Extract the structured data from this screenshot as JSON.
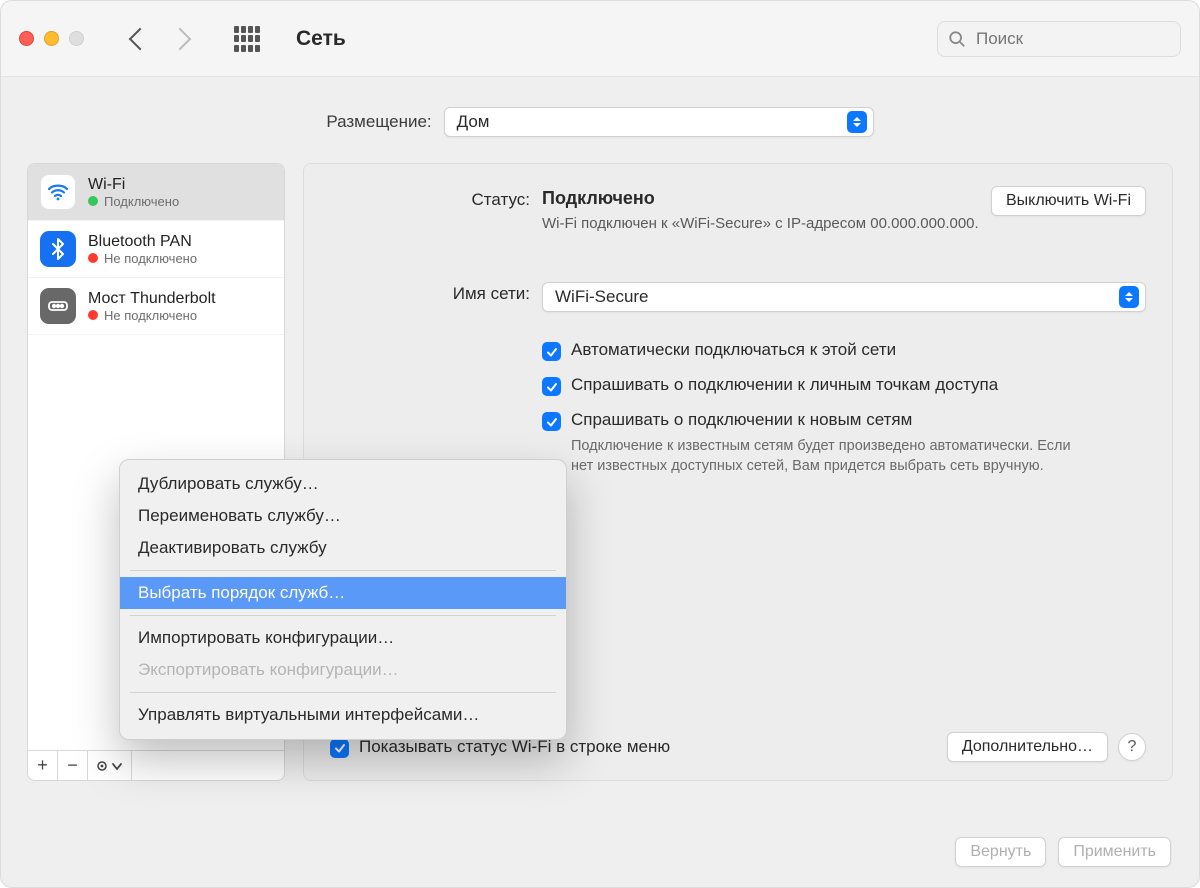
{
  "toolbar": {
    "title": "Сеть",
    "search_placeholder": "Поиск"
  },
  "location": {
    "label": "Размещение:",
    "value": "Дом"
  },
  "sidebar": {
    "services": [
      {
        "name": "Wi-Fi",
        "status": "Подключено",
        "status_color": "green",
        "icon": "wifi",
        "selected": true
      },
      {
        "name": "Bluetooth PAN",
        "status": "Не подключено",
        "status_color": "red",
        "icon": "bt",
        "selected": false
      },
      {
        "name": "Мост Thunderbolt",
        "status": "Не подключено",
        "status_color": "red",
        "icon": "tb",
        "selected": false
      }
    ]
  },
  "details": {
    "status_label": "Статус:",
    "status_value": "Подключено",
    "status_sub": "Wi-Fi подключен к «WiFi-Secure» с IP-адресом 00.000.000.000.",
    "turn_off_label": "Выключить Wi-Fi",
    "network_label": "Имя сети:",
    "network_value": "WiFi-Secure",
    "checks": [
      {
        "checked": true,
        "label": "Автоматически подключаться к этой сети"
      },
      {
        "checked": true,
        "label": "Спрашивать о подключении к личным точкам доступа"
      },
      {
        "checked": true,
        "label": "Спрашивать о подключении к новым сетям",
        "sub": "Подключение к известным сетям будет произведено автоматически. Если нет известных доступных сетей, Вам придется выбрать сеть вручную."
      }
    ],
    "show_status_label": "Показывать статус Wi-Fi в строке меню",
    "advanced_label": "Дополнительно…"
  },
  "footer": {
    "revert": "Вернуть",
    "apply": "Применить"
  },
  "context_menu": {
    "items": [
      {
        "label": "Дублировать службу…",
        "state": "normal"
      },
      {
        "label": "Переименовать службу…",
        "state": "normal"
      },
      {
        "label": "Деактивировать службу",
        "state": "normal"
      },
      {
        "type": "sep"
      },
      {
        "label": "Выбрать порядок служб…",
        "state": "selected"
      },
      {
        "type": "sep"
      },
      {
        "label": "Импортировать конфигурации…",
        "state": "normal"
      },
      {
        "label": "Экспортировать конфигурации…",
        "state": "disabled"
      },
      {
        "type": "sep"
      },
      {
        "label": "Управлять виртуальными интерфейсами…",
        "state": "normal"
      }
    ]
  }
}
